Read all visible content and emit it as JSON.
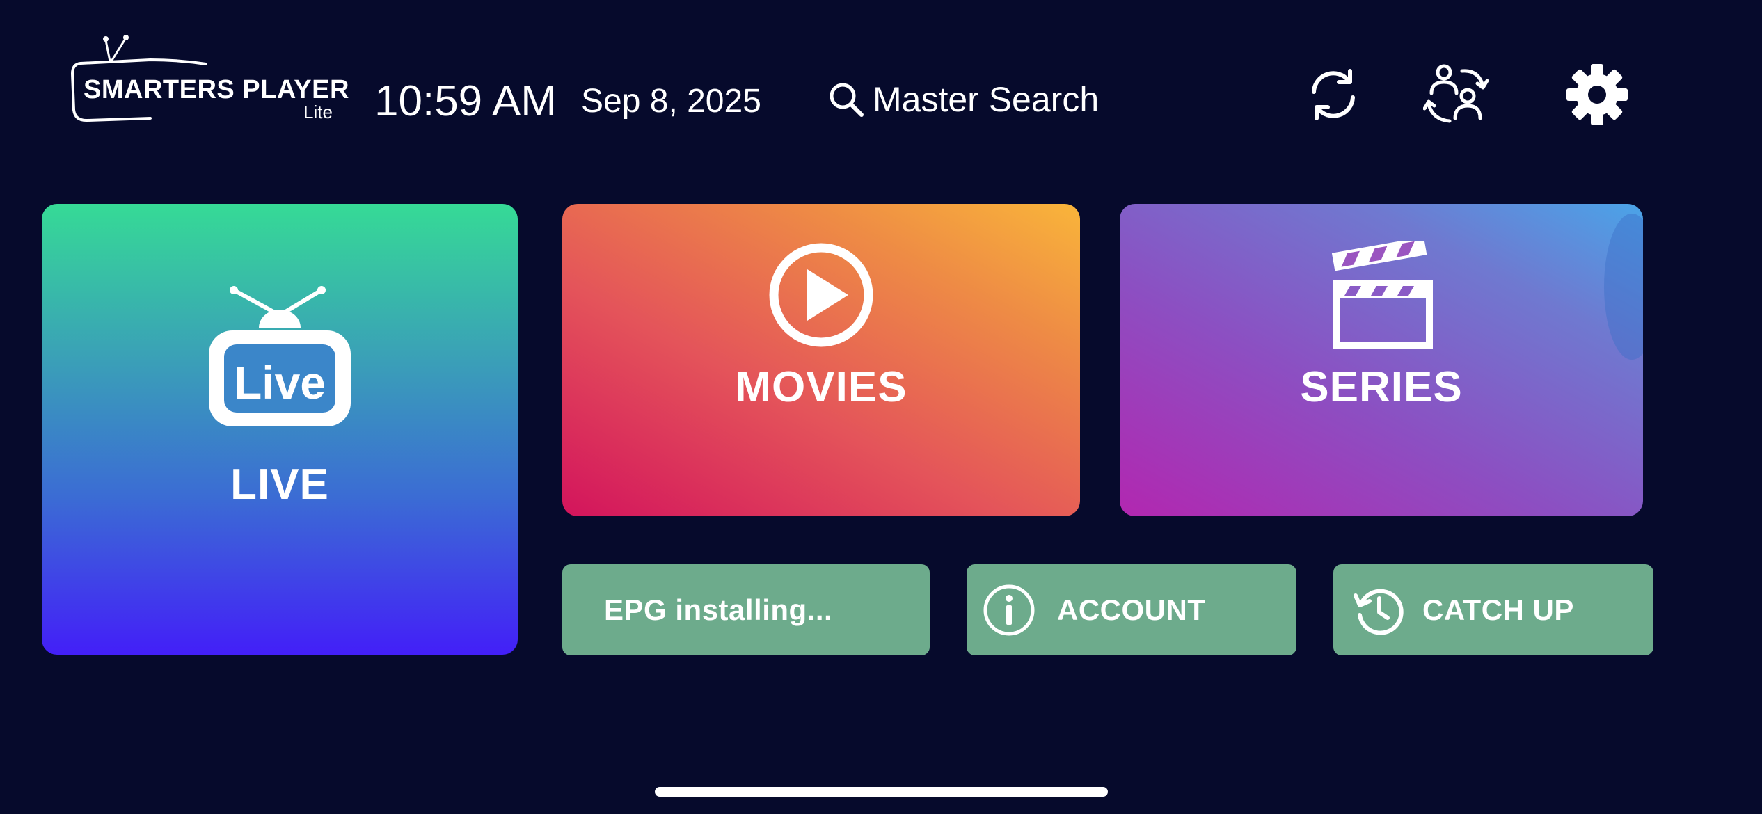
{
  "header": {
    "logo_text": "SMARTERS PLAYER",
    "logo_sub": "Lite",
    "time": "10:59 AM",
    "date": "Sep 8, 2025",
    "search_label": "Master Search",
    "icons": [
      "refresh-icon",
      "switch-user-icon",
      "gear-icon"
    ]
  },
  "tiles": {
    "live": {
      "label": "LIVE",
      "badge_text": "Live",
      "icon": "live-tv-icon"
    },
    "movies": {
      "label": "MOVIES",
      "icon": "play-circle-icon"
    },
    "series": {
      "label": "SERIES",
      "icon": "clapperboard-icon"
    }
  },
  "buttons": {
    "epg": "EPG installing...",
    "account": "ACCOUNT",
    "catch_up": "CATCH UP"
  },
  "colors": {
    "background": "#060a2c",
    "button_green": "#6dab8c"
  }
}
